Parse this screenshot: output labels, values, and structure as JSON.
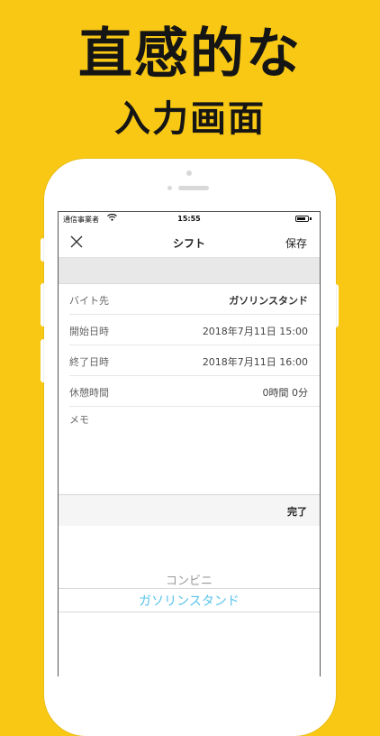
{
  "headline": {
    "line1": "直感的な",
    "line2": "入力画面"
  },
  "status_bar": {
    "carrier": "通信事業者",
    "time": "15:55"
  },
  "navbar": {
    "title": "シフト",
    "save_label": "保存"
  },
  "form": {
    "rows": [
      {
        "label": "バイト先",
        "value": "ガソリンスタンド"
      },
      {
        "label": "開始日時",
        "value": "2018年7月11日  15:00"
      },
      {
        "label": "終了日時",
        "value": "2018年7月11日  16:00"
      },
      {
        "label": "休憩時間",
        "value": "0時間 0分"
      }
    ],
    "memo_label": "メモ"
  },
  "picker": {
    "done_label": "完了",
    "options": [
      "コンビニ",
      "ガソリンスタンド"
    ],
    "selected": "ガソリンスタンド"
  },
  "colors": {
    "background": "#F8C814",
    "picker_selected": "#59C3EA"
  }
}
